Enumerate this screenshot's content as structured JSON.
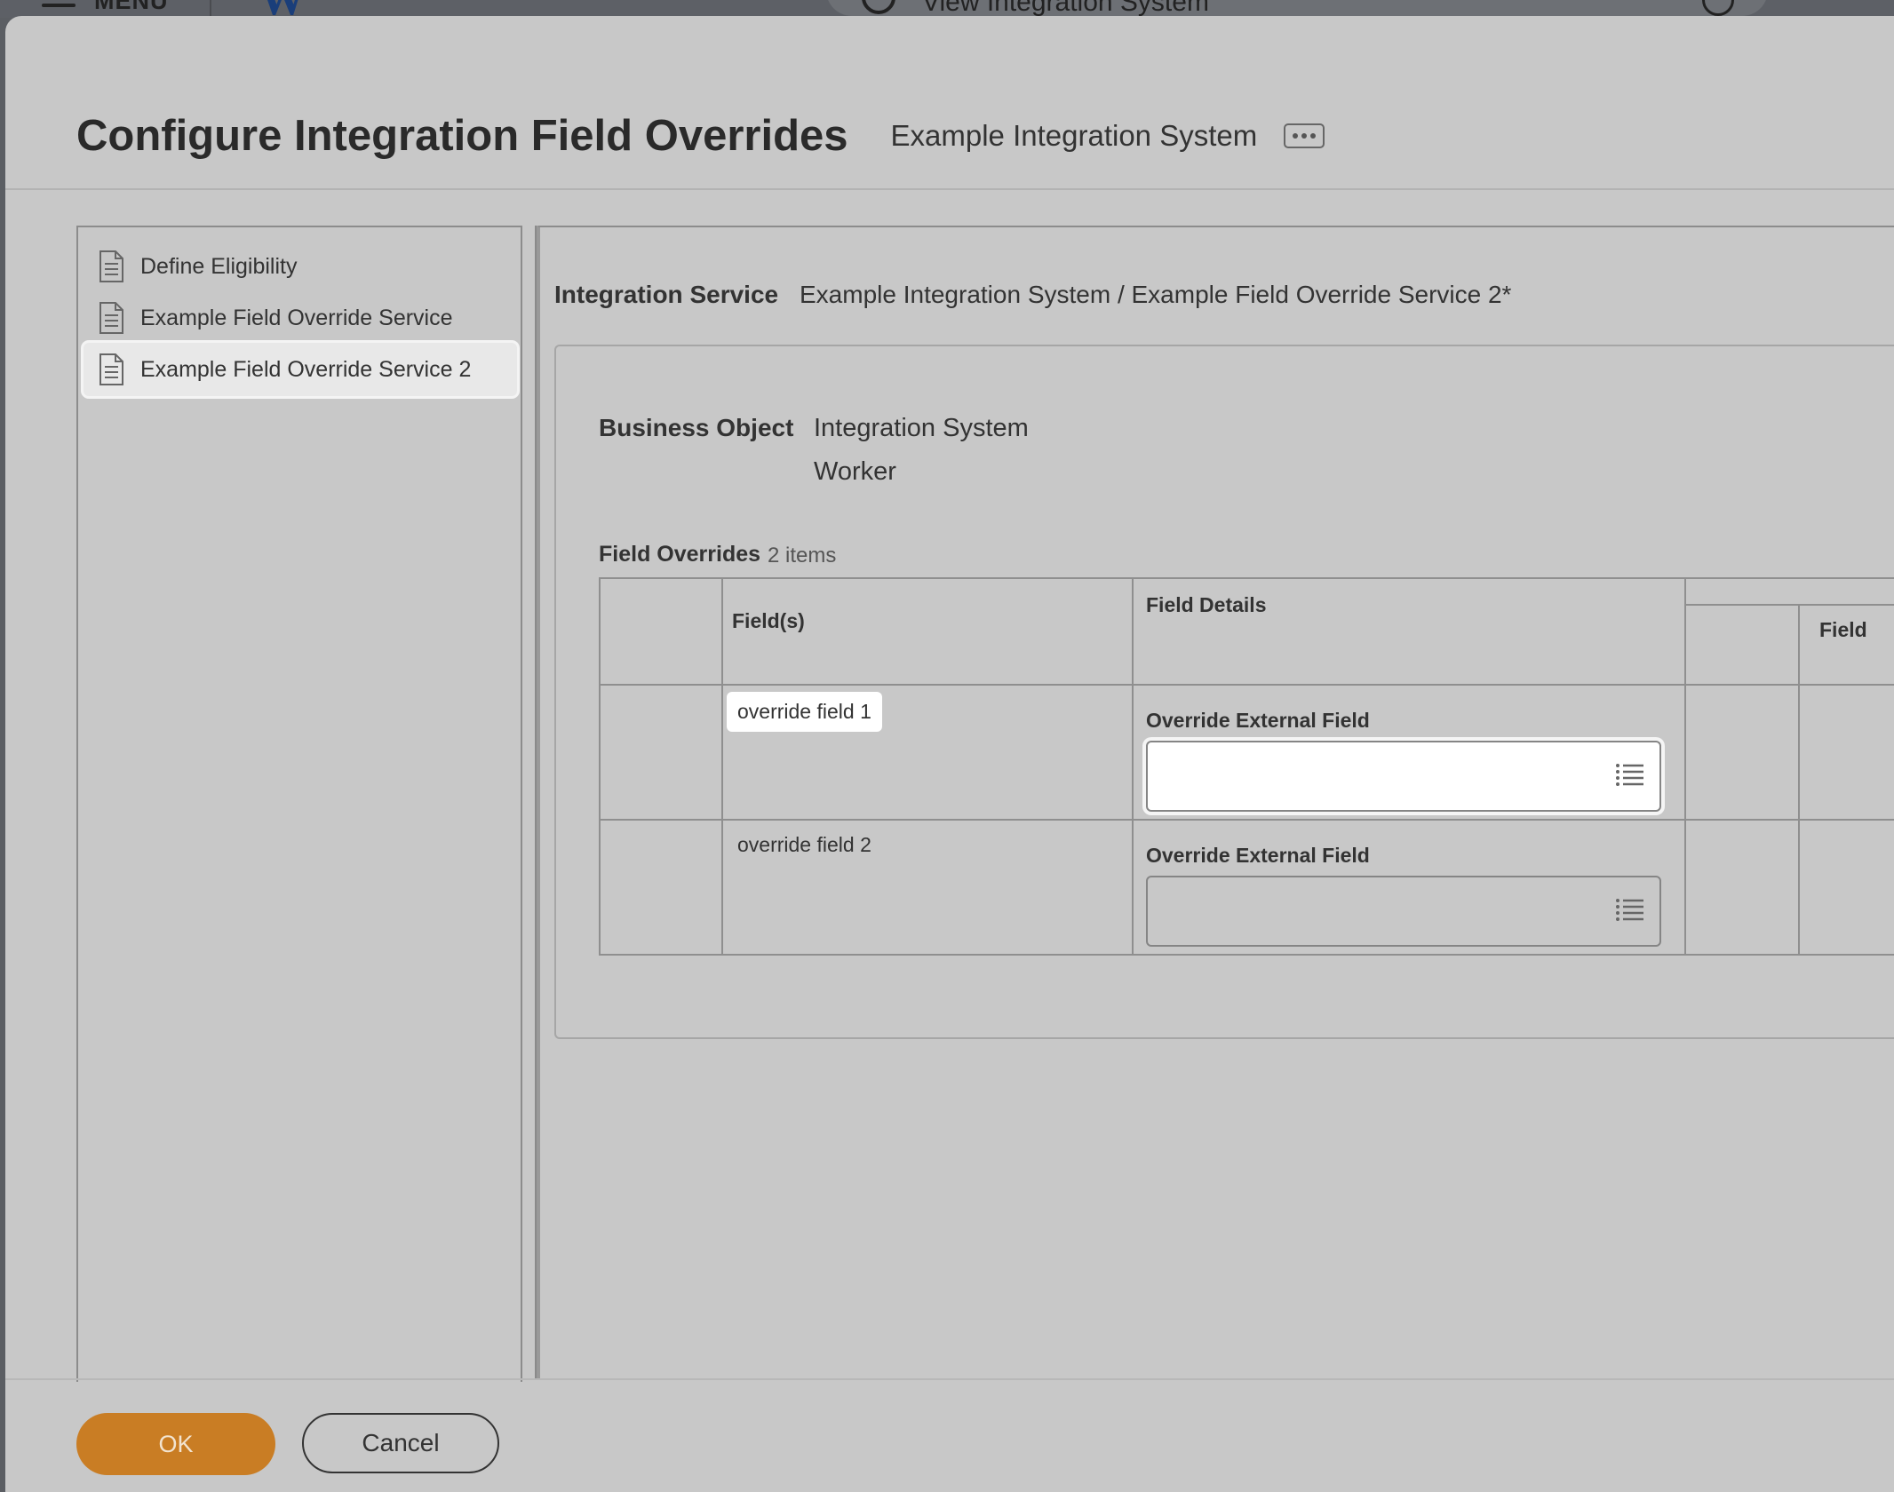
{
  "topbar": {
    "menu_label": "MENU",
    "logo_letter": "W",
    "search_text": "View Integration System"
  },
  "dialog": {
    "title": "Configure Integration Field Overrides",
    "subtitle": "Example Integration System"
  },
  "sidebar": {
    "items": [
      {
        "label": "Define Eligibility",
        "icon": "document-icon",
        "selected": false
      },
      {
        "label": "Example Field Override Service",
        "icon": "document-icon",
        "selected": false
      },
      {
        "label": "Example Field Override Service 2",
        "icon": "document-icon",
        "selected": true
      }
    ]
  },
  "integration_service": {
    "label": "Integration Service",
    "value": "Example Integration System / Example Field Override Service 2*"
  },
  "business_object": {
    "label": "Business Object",
    "values": [
      "Integration System",
      "Worker"
    ]
  },
  "field_overrides": {
    "label": "Field Overrides",
    "count": "2 items",
    "columns": [
      "Field(s)",
      "Field Details",
      "Field"
    ],
    "rows": [
      {
        "field": "override field 1",
        "detail_label": "Override External Field",
        "value": "",
        "active": true
      },
      {
        "field": "override field 2",
        "detail_label": "Override External Field",
        "value": "",
        "active": false
      }
    ]
  },
  "footer": {
    "ok_label": "OK",
    "cancel_label": "Cancel"
  },
  "colors": {
    "primary_button": "#c97d24",
    "modal_bg": "#c8c8c8",
    "logo_blue": "#1a3e7a"
  }
}
